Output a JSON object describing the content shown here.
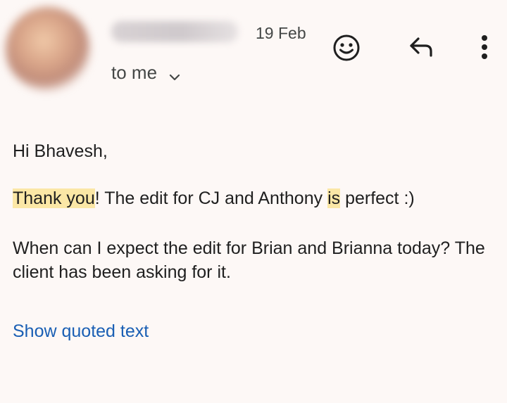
{
  "header": {
    "sender_name": "Segun So...",
    "date": "19 Feb",
    "recipient_label": "to me"
  },
  "icons": {
    "add_reaction": "emoji-icon",
    "reply": "reply-icon",
    "more": "more-vert-icon",
    "expand": "chevron-down-icon"
  },
  "message": {
    "greeting": "Hi Bhavesh,",
    "line1": {
      "part1": "Thank you",
      "part2": "! The edit for CJ and Anthony ",
      "part3": "is",
      "part4": " perfect :)"
    },
    "paragraph2": "When can I expect the edit for Brian and Brianna today? The client has been asking for it."
  },
  "actions": {
    "show_quoted": "Show quoted text"
  },
  "colors": {
    "background": "#fdf8f6",
    "highlight": "#fbe7a6",
    "link": "#1a5fb4",
    "muted_text": "#444746"
  }
}
